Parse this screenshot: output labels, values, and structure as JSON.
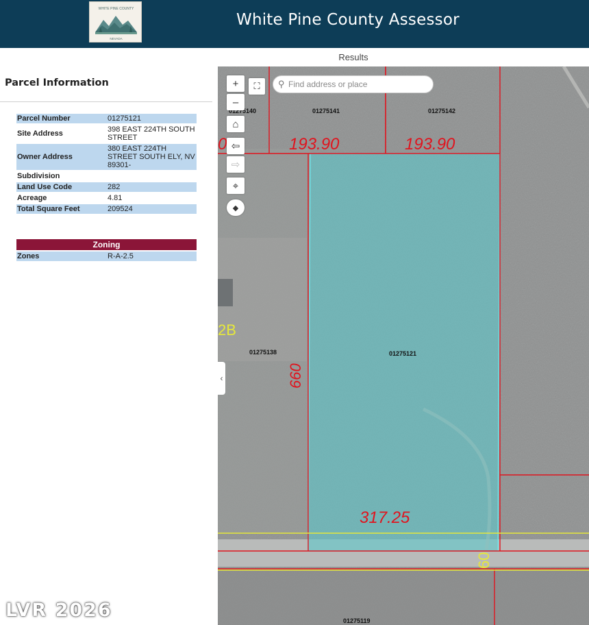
{
  "header": {
    "title": "White Pine County Assessor",
    "logo": {
      "top_text": "WHITE PINE COUNTY",
      "bottom_text": "NEVADA"
    }
  },
  "results_label": "Results",
  "panel": {
    "title": "Parcel Information",
    "rows": [
      {
        "label": "Parcel Number",
        "value": "01275121",
        "shaded": true
      },
      {
        "label": "Site Address",
        "value": "398 EAST 224TH SOUTH STREET",
        "shaded": false
      },
      {
        "label": "Owner Address",
        "value": "380 EAST 224TH STREET SOUTH ELY, NV 89301-",
        "shaded": true
      },
      {
        "label": "Subdivision",
        "value": "",
        "shaded": false
      },
      {
        "label": "Land Use Code",
        "value": "282",
        "shaded": true
      },
      {
        "label": "Acreage",
        "value": "4.81",
        "shaded": false
      },
      {
        "label": "Total Square Feet",
        "value": "209524",
        "shaded": true
      }
    ],
    "zoning": {
      "heading": "Zoning",
      "rows": [
        {
          "label": "Zones",
          "value": "R-A-2.5"
        }
      ]
    }
  },
  "map": {
    "search_placeholder": "Find address or place",
    "controls": [
      {
        "name": "zoom-in-button",
        "glyph": "+"
      },
      {
        "name": "zoom-out-button",
        "glyph": "–"
      },
      {
        "name": "home-button",
        "glyph": "⌂"
      },
      {
        "name": "previous-extent-button",
        "glyph": "⇦"
      },
      {
        "name": "next-extent-button",
        "glyph": "⇨"
      },
      {
        "name": "locate-button",
        "glyph": "⌖"
      },
      {
        "name": "compass-button",
        "glyph": "◆"
      }
    ],
    "basemap_toggle_glyph": "⛶",
    "collapse_glyph": "‹",
    "parcel_labels": [
      "01275140",
      "01275141",
      "01275142",
      "01275138",
      "01275121",
      "01275119"
    ],
    "dimension_labels": [
      "193.90",
      "193.90",
      "660",
      "317.25",
      "60",
      "2B",
      "0"
    ],
    "colors": {
      "header": "#0d3d57",
      "zoning": "#8b1538",
      "shade": "#bdd7ee",
      "parcel_fill": "#5ec8cc",
      "lot_line": "#e0141e",
      "road_line": "#e6e83a"
    }
  },
  "watermark": "LVR 2026"
}
